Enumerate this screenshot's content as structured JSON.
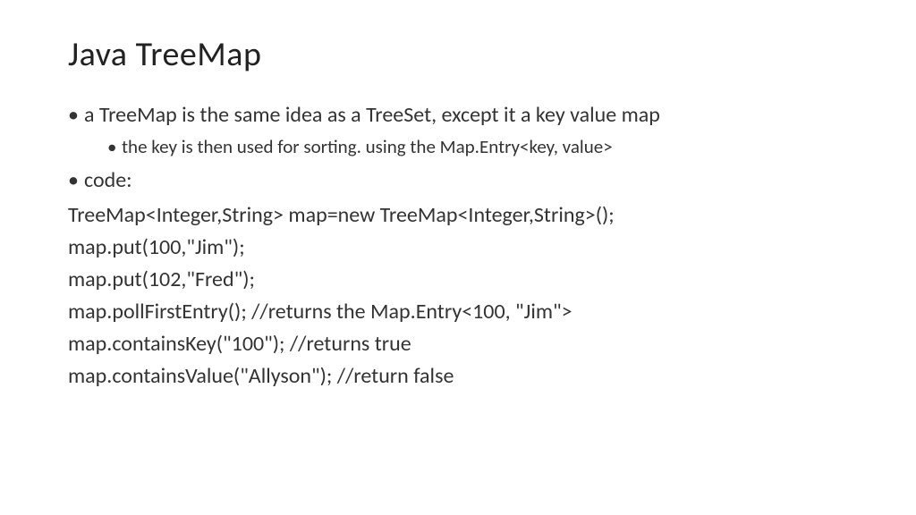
{
  "title": "Java TreeMap",
  "bullet1": "a TreeMap is the same idea as a TreeSet, except it a key value map",
  "bullet1_sub": "the key is then used for sorting.  using the Map.Entry<key, value>",
  "bullet2": "code:",
  "code": {
    "line1": "TreeMap<Integer,String> map=new TreeMap<Integer,String>();",
    "line2": "map.put(100,\"Jim\");",
    "line3": "map.put(102,\"Fred\");",
    "line4": "map.pollFirstEntry(); //returns the Map.Entry<100, \"Jim\">",
    "line5": "map.containsKey(\"100\"); //returns true",
    "line6": "map.containsValue(\"Allyson\"); //return false"
  }
}
